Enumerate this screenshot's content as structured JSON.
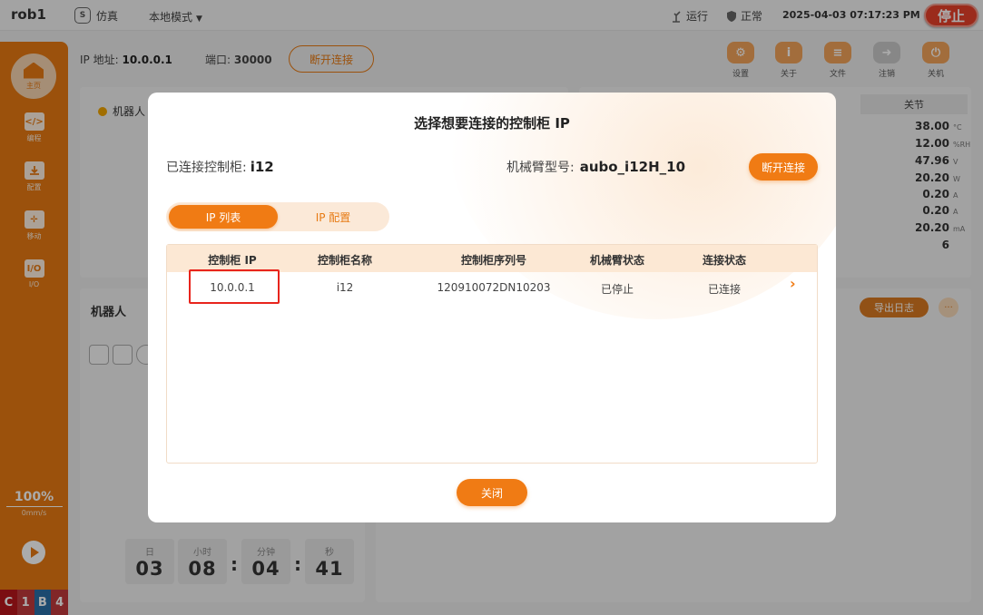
{
  "topbar": {
    "title": "rob1",
    "sim_icon": "S",
    "sim_label": "仿真",
    "mode_label": "本地模式",
    "run_label": "运行",
    "normal_label": "正常",
    "datetime": "2025-04-03 07:17:23 PM",
    "stop_label": "停止"
  },
  "sidebar": {
    "home": "主页",
    "program": "编程",
    "config": "配置",
    "move": "移动",
    "io": "I/O",
    "program_glyph": "</>",
    "move_glyph": "✛",
    "io_glyph": "I/O",
    "speed_pct": "100%",
    "speed_unit": "0mm/s",
    "status": [
      {
        "text": "C",
        "color": "#b8161b"
      },
      {
        "text": "1",
        "color": "#c03a3d"
      },
      {
        "text": "B",
        "color": "#2b6fa8"
      },
      {
        "text": "4",
        "color": "#c03a3d"
      }
    ]
  },
  "connection": {
    "ip_label": "IP 地址:",
    "ip_value": "10.0.0.1",
    "port_label": "端口:",
    "port_value": "30000",
    "disconnect_label": "断开连接"
  },
  "toolbar": {
    "settings": "设置",
    "about": "关于",
    "file": "文件",
    "logout": "注销",
    "shutdown": "关机",
    "colors": {
      "settings": "#f2a35a",
      "about": "#f2a35a",
      "file": "#f2a35a",
      "logout": "#c9c9c9",
      "shutdown": "#f2a35a"
    }
  },
  "panels": {
    "robot_status": "机器人",
    "robot_title": "机器人",
    "joint_tab": "关节",
    "export_log": "导出日志",
    "more": "···",
    "sensors": [
      {
        "value": "38.00",
        "unit": "°C"
      },
      {
        "value": "12.00",
        "unit": "%RH"
      },
      {
        "value": "47.96",
        "unit": "V"
      },
      {
        "value": "20.20",
        "unit": "W"
      },
      {
        "value": "0.20",
        "unit": "A"
      },
      {
        "value": "0.20",
        "unit": "A"
      },
      {
        "value": "20.20",
        "unit": "mA"
      },
      {
        "value": "6",
        "unit": ""
      }
    ],
    "timer": {
      "day_label": "日",
      "day": "03",
      "hour_label": "小时",
      "hour": "08",
      "minute_label": "分钟",
      "minute": "04",
      "second_label": "秒",
      "second": "41"
    }
  },
  "modal": {
    "title": "选择想要连接的控制柜 IP",
    "connected_label": "已连接控制柜:",
    "connected_value": "i12",
    "arm_label": "机械臂型号:",
    "arm_value": "aubo_i12H_10",
    "disconnect_label": "断开连接",
    "tabs": [
      "IP 列表",
      "IP 配置"
    ],
    "columns": [
      "控制柜 IP",
      "控制柜名称",
      "控制柜序列号",
      "机械臂状态",
      "连接状态"
    ],
    "rows": [
      [
        "10.0.0.1",
        "i12",
        "120910072DN10203",
        "已停止",
        "已连接"
      ]
    ],
    "row_arrow": "›",
    "close_label": "关闭",
    "accent": "#f07b14"
  }
}
